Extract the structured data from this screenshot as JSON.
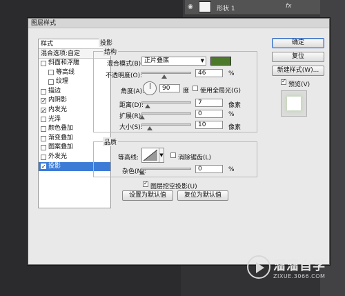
{
  "background": {
    "layer_name": "形状 1",
    "layer_fx": "fx"
  },
  "dialog": {
    "title": "图层样式",
    "left_panel": {
      "header": "样式",
      "blend_options": "混合选项:自定",
      "items": [
        {
          "label": "斜面和浮雕",
          "checked": false,
          "sub": false,
          "selected": false
        },
        {
          "label": "等高线",
          "checked": false,
          "sub": true,
          "selected": false
        },
        {
          "label": "纹理",
          "checked": false,
          "sub": true,
          "selected": false
        },
        {
          "label": "描边",
          "checked": false,
          "sub": false,
          "selected": false
        },
        {
          "label": "内阴影",
          "checked": true,
          "sub": false,
          "selected": false
        },
        {
          "label": "内发光",
          "checked": true,
          "sub": false,
          "selected": false
        },
        {
          "label": "光泽",
          "checked": false,
          "sub": false,
          "selected": false
        },
        {
          "label": "颜色叠加",
          "checked": false,
          "sub": false,
          "selected": false
        },
        {
          "label": "渐变叠加",
          "checked": false,
          "sub": false,
          "selected": false
        },
        {
          "label": "图案叠加",
          "checked": false,
          "sub": false,
          "selected": false
        },
        {
          "label": "外发光",
          "checked": false,
          "sub": false,
          "selected": false
        },
        {
          "label": "投影",
          "checked": true,
          "sub": false,
          "selected": true
        }
      ]
    },
    "drop_shadow": {
      "section_title": "投影",
      "structure_title": "结构",
      "blend_mode_label": "混合模式(B):",
      "blend_mode_value": "正片叠底",
      "color": "#4d7a2a",
      "opacity_label": "不透明度(O):",
      "opacity_value": "46",
      "percent": "%",
      "angle_label": "角度(A):",
      "angle_value": "90",
      "degree": "度",
      "global_light_label": "使用全局光(G)",
      "distance_label": "距离(D):",
      "distance_value": "7",
      "spread_label": "扩展(R):",
      "spread_value": "0",
      "size_label": "大小(S):",
      "size_value": "10",
      "px_unit": "像素",
      "quality_title": "品质",
      "contour_label": "等高线:",
      "anti_alias_label": "消除锯齿(L)",
      "noise_label": "杂色(N):",
      "noise_value": "0",
      "knockout_label": "图层挖空投影(U)",
      "make_default": "设置为默认值",
      "reset_default": "复位为默认值",
      "slider_levels": {
        "opacity": 46,
        "distance": 7,
        "spread": 0,
        "size": 10,
        "noise": 0
      }
    },
    "buttons": {
      "ok": "确定",
      "reset": "复位",
      "new_style": "新建样式(W)...",
      "preview_label": "预览(V)"
    }
  },
  "watermark": {
    "title": "溜溜自学",
    "url": "ZIXUE.3066.COM"
  }
}
